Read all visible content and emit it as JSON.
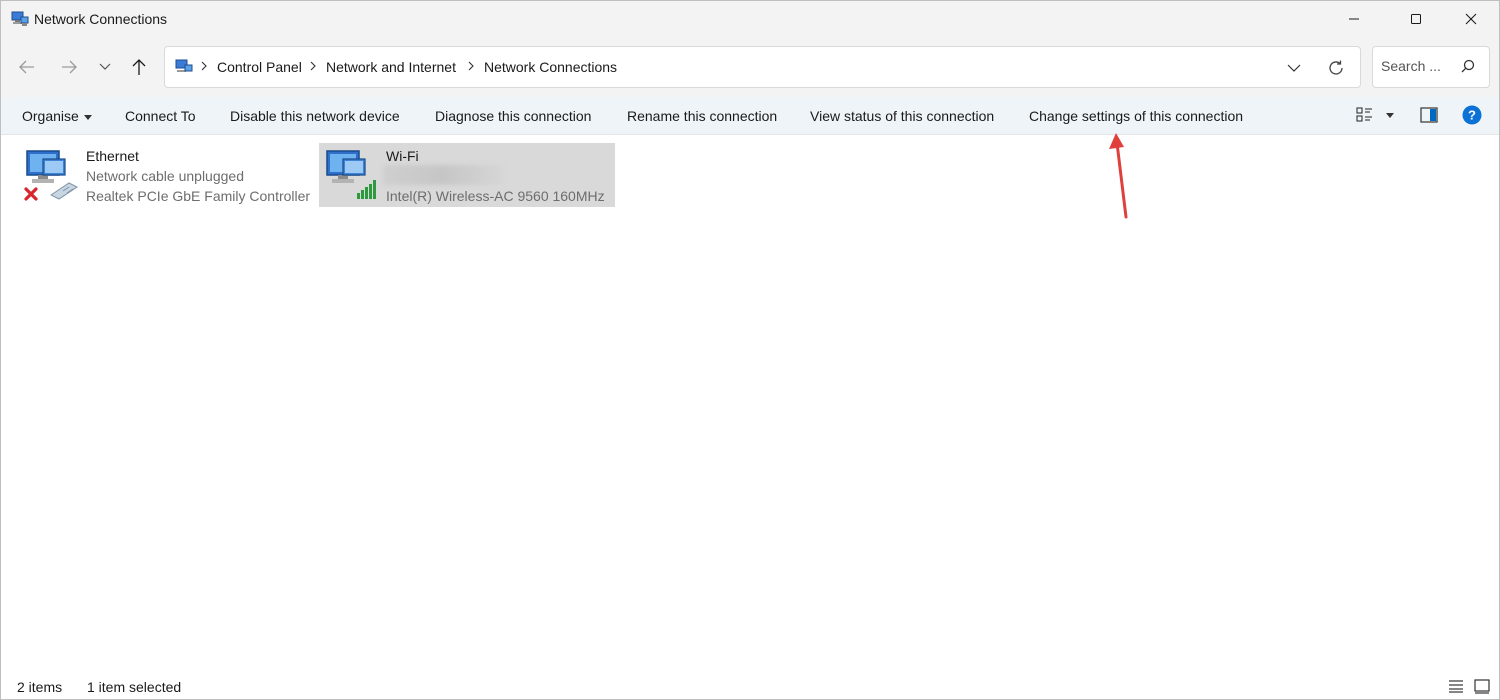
{
  "window": {
    "title": "Network Connections"
  },
  "address": {
    "crumbs": [
      "Control Panel",
      "Network and Internet",
      "Network Connections"
    ]
  },
  "search": {
    "placeholder": "Search ..."
  },
  "commands": {
    "organise": "Organise",
    "connect_to": "Connect To",
    "disable": "Disable this network device",
    "diagnose": "Diagnose this connection",
    "rename": "Rename this connection",
    "view_status": "View status of this connection",
    "change_settings": "Change settings of this connection"
  },
  "items": [
    {
      "name": "Ethernet",
      "status": "Network cable unplugged",
      "device": "Realtek PCIe GbE Family Controller",
      "icon": "ethernet-disconnected-icon"
    },
    {
      "name": "Wi-Fi",
      "status": "",
      "device": "Intel(R) Wireless-AC 9560 160MHz",
      "icon": "wifi-adapter-icon",
      "selected": true
    }
  ],
  "statusbar": {
    "count": "2 items",
    "selection": "1 item selected"
  },
  "colors": {
    "accent": "#0067c0",
    "annotation": "#e0403c",
    "selection": "#d9d9d9",
    "command_bar": "#eff4f9"
  }
}
